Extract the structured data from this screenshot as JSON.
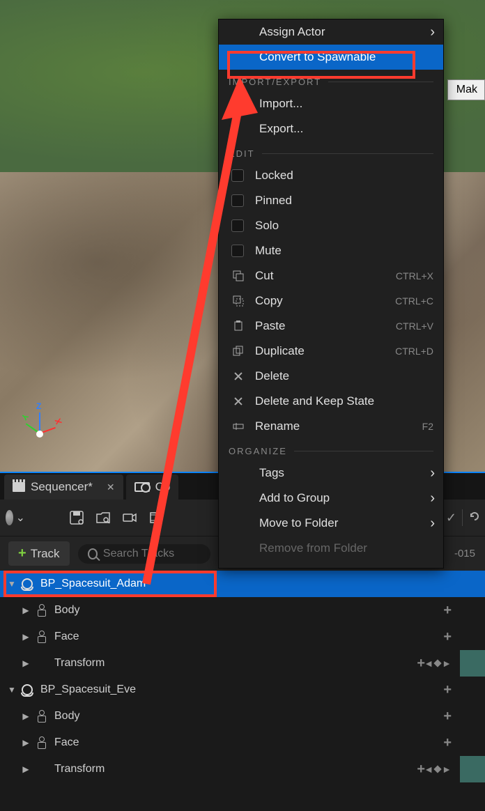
{
  "viewport": {
    "axes": [
      "X",
      "Y",
      "Z"
    ]
  },
  "side_button": "Mak",
  "tabs": [
    {
      "label": "Sequencer*",
      "active": true
    },
    {
      "label": "Co"
    }
  ],
  "toolbar": {},
  "track_bar": {
    "add_label": "Track",
    "search_placeholder": "Search Tracks",
    "timeline_number": "-015"
  },
  "outliner": [
    {
      "label": "BP_Spacesuit_Adam",
      "type": "actor",
      "level": 0,
      "selected": true,
      "expanded": true,
      "add": true
    },
    {
      "label": "Body",
      "type": "skeletal",
      "level": 1,
      "expanded": false,
      "add": true
    },
    {
      "label": "Face",
      "type": "skeletal",
      "level": 1,
      "expanded": false,
      "add": true
    },
    {
      "label": "Transform",
      "type": "transform",
      "level": 1,
      "expanded": false,
      "add": true,
      "keys": true,
      "lane": "green"
    },
    {
      "label": "BP_Spacesuit_Eve",
      "type": "actor",
      "level": 0,
      "expanded": true,
      "add": true
    },
    {
      "label": "Body",
      "type": "skeletal",
      "level": 1,
      "expanded": false,
      "add": true
    },
    {
      "label": "Face",
      "type": "skeletal",
      "level": 1,
      "expanded": false,
      "add": true
    },
    {
      "label": "Transform",
      "type": "transform",
      "level": 1,
      "expanded": false,
      "add": true,
      "keys": true,
      "lane": "green"
    }
  ],
  "context_menu": {
    "items": [
      {
        "label": "Assign Actor",
        "sub": true,
        "indent": true
      },
      {
        "label": "Convert to Spawnable",
        "selected": true,
        "indent": true
      },
      {
        "section": "IMPORT/EXPORT"
      },
      {
        "label": "Import...",
        "indent": true
      },
      {
        "label": "Export...",
        "indent": true
      },
      {
        "section": "EDIT"
      },
      {
        "label": "Locked",
        "check": true
      },
      {
        "label": "Pinned",
        "check": true
      },
      {
        "label": "Solo",
        "check": true
      },
      {
        "label": "Mute",
        "check": true
      },
      {
        "label": "Cut",
        "icon": "cut",
        "kbd": "CTRL+X"
      },
      {
        "label": "Copy",
        "icon": "copy",
        "kbd": "CTRL+C"
      },
      {
        "label": "Paste",
        "icon": "paste",
        "kbd": "CTRL+V"
      },
      {
        "label": "Duplicate",
        "icon": "dup",
        "kbd": "CTRL+D"
      },
      {
        "label": "Delete",
        "icon": "x"
      },
      {
        "label": "Delete and Keep State",
        "icon": "x"
      },
      {
        "label": "Rename",
        "icon": "rename",
        "kbd": "F2"
      },
      {
        "section": "ORGANIZE"
      },
      {
        "label": "Tags",
        "sub": true,
        "indent": true
      },
      {
        "label": "Add to Group",
        "sub": true,
        "indent": true
      },
      {
        "label": "Move to Folder",
        "sub": true,
        "indent": true
      },
      {
        "label": "Remove from Folder",
        "disabled": true,
        "indent": true
      }
    ]
  }
}
